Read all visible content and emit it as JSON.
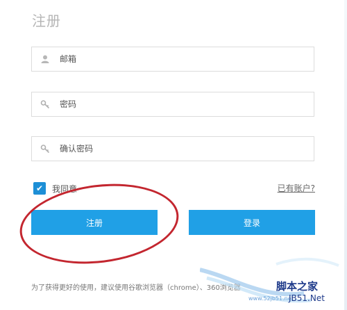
{
  "page": {
    "title": "注册"
  },
  "form": {
    "email_placeholder": "邮箱",
    "password_placeholder": "密码",
    "confirm_placeholder": "确认密码",
    "agree_label": "我同意",
    "agree_checked": true,
    "have_account_link": "已有账户?"
  },
  "buttons": {
    "register": "注册",
    "login": "登录"
  },
  "footer": {
    "note": "为了获得更好的使用，建议使用谷歌浏览器（chrome）、360浏览器"
  },
  "watermark": {
    "text": "脚本之家",
    "sub": "www.52jb51.net",
    "jb": "JB51.Net"
  },
  "colors": {
    "accent": "#20a0e6",
    "checkbox": "#1d8fd6",
    "annotation": "#c3262f"
  },
  "icons": {
    "email": "user-icon",
    "password": "key-icon",
    "confirm": "key-icon",
    "checkbox": "check-icon"
  }
}
